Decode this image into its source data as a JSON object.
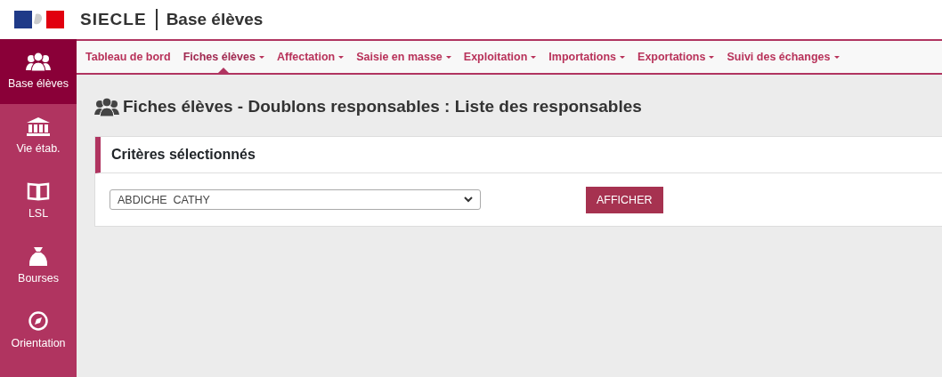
{
  "header": {
    "app_name": "SIECLE",
    "module": "Base élèves"
  },
  "sidebar": {
    "items": [
      {
        "label": "Base élèves",
        "kind": "people",
        "selected": true
      },
      {
        "label": "Vie étab.",
        "kind": "building",
        "selected": false
      },
      {
        "label": "LSL",
        "kind": "book",
        "selected": false
      },
      {
        "label": "Bourses",
        "kind": "bag",
        "selected": false
      },
      {
        "label": "Orientation",
        "kind": "compass",
        "selected": false
      }
    ]
  },
  "menu": [
    {
      "label": "Tableau de bord",
      "dropdown": false,
      "selected": false
    },
    {
      "label": "Fiches élèves",
      "dropdown": true,
      "selected": true
    },
    {
      "label": "Affectation",
      "dropdown": true,
      "selected": false
    },
    {
      "label": "Saisie en masse",
      "dropdown": true,
      "selected": false
    },
    {
      "label": "Exploitation",
      "dropdown": true,
      "selected": false
    },
    {
      "label": "Importations",
      "dropdown": true,
      "selected": false
    },
    {
      "label": "Exportations",
      "dropdown": true,
      "selected": false
    },
    {
      "label": "Suivi des échanges",
      "dropdown": true,
      "selected": false
    }
  ],
  "page_title": "Fiches élèves - Doublons responsables : Liste des responsables",
  "criteria": {
    "title": "Critères sélectionnés",
    "select_value": "ABDICHE  CATHY",
    "button": "AFFICHER"
  }
}
